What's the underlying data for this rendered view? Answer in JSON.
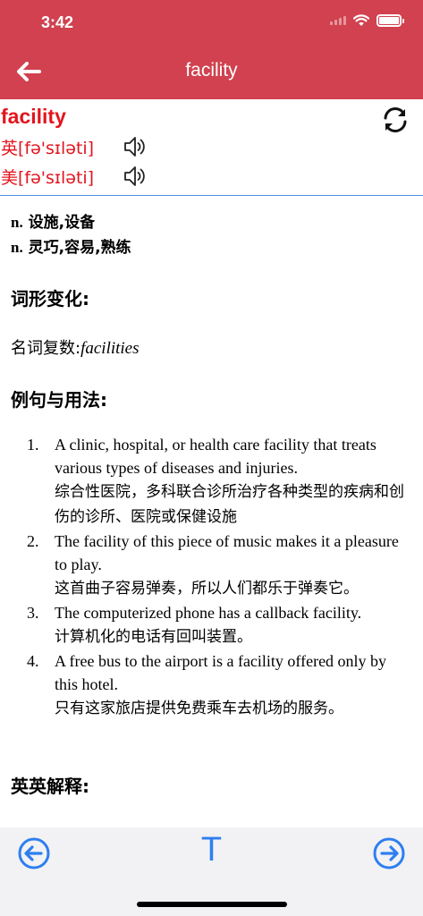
{
  "status": {
    "time": "3:42"
  },
  "header": {
    "title": "facility",
    "back_icon": "arrow-left-icon"
  },
  "word": {
    "text": "facility",
    "pronunciations": [
      {
        "label": "英[fə'sɪləti]",
        "icon": "speaker-icon"
      },
      {
        "label": "美[fə'sɪləti]",
        "icon": "speaker-icon"
      }
    ],
    "refresh_icon": "refresh-icon"
  },
  "definitions": [
    {
      "pos": "n.",
      "meaning": "设施,设备"
    },
    {
      "pos": "n.",
      "meaning": "灵巧,容易,熟练"
    }
  ],
  "inflection": {
    "title": "词形变化:",
    "label": "名词复数:",
    "value": "facilities"
  },
  "examples": {
    "title": "例句与用法:",
    "items": [
      {
        "num": "1.",
        "en": "A clinic, hospital, or health care facility that treats various types of diseases and injuries.",
        "zh": "综合性医院，多科联合诊所治疗各种类型的疾病和创伤的诊所、医院或保健设施"
      },
      {
        "num": "2.",
        "en": "The facility of this piece of music makes it a pleasure to play.",
        "zh": "这首曲子容易弹奏，所以人们都乐于弹奏它。"
      },
      {
        "num": "3.",
        "en": "The computerized phone has a callback facility.",
        "zh": "计算机化的电话有回叫装置。"
      },
      {
        "num": "4.",
        "en": "A free bus to the airport is a facility offered only by this hotel.",
        "zh": "只有这家旅店提供免费乘车去机场的服务。"
      }
    ]
  },
  "english_definition": {
    "title": "英英解释:"
  },
  "bottom_bar": {
    "prev_icon": "arrow-circle-left-icon",
    "font_label": "T",
    "next_icon": "arrow-circle-right-icon"
  },
  "colors": {
    "header": "#d1414f",
    "accent_red": "#e3141d",
    "accent_blue": "#2e7ff0"
  }
}
